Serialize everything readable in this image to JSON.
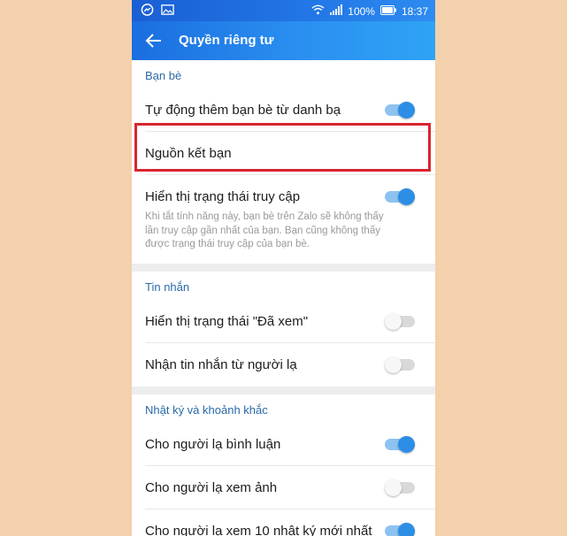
{
  "status_bar": {
    "battery": "100%",
    "time": "18:37",
    "icons": [
      "messenger-icon",
      "image-icon",
      "wifi-icon",
      "signal-icon",
      "battery-icon"
    ]
  },
  "header": {
    "title": "Quyền riêng tư",
    "back_icon": "arrow-left-icon"
  },
  "sections": {
    "friends": {
      "title": "Bạn bè",
      "auto_add": {
        "label": "Tự động thêm bạn bè từ danh bạ",
        "enabled": true
      },
      "friend_source": {
        "label": "Nguồn kết bạn"
      },
      "show_status": {
        "label": "Hiển thị trạng thái truy cập",
        "enabled": true
      },
      "description": "Khi tắt tính năng này, bạn bè trên Zalo sẽ không thấy lần truy cập gần nhất của bạn. Bạn cũng không thấy được trạng thái truy cập của bạn bè."
    },
    "messages": {
      "title": "Tin nhắn",
      "seen_status": {
        "label": "Hiển thị trạng thái \"Đã xem\"",
        "enabled": false
      },
      "from_strangers": {
        "label": "Nhận tin nhắn từ người lạ",
        "enabled": false
      }
    },
    "timeline": {
      "title": "Nhật ký và khoảnh khắc",
      "stranger_comment": {
        "label": "Cho người lạ bình luận",
        "enabled": true
      },
      "stranger_photos": {
        "label": "Cho người lạ xem ảnh",
        "enabled": false
      },
      "stranger_posts": {
        "label": "Cho người lạ xem 10 nhật ký mới nhất",
        "enabled": true
      }
    }
  },
  "colors": {
    "accent": "#2d8ee6",
    "highlight_border": "#d8262f",
    "section_title": "#2a6aa8",
    "background": "#f3d1ac"
  }
}
